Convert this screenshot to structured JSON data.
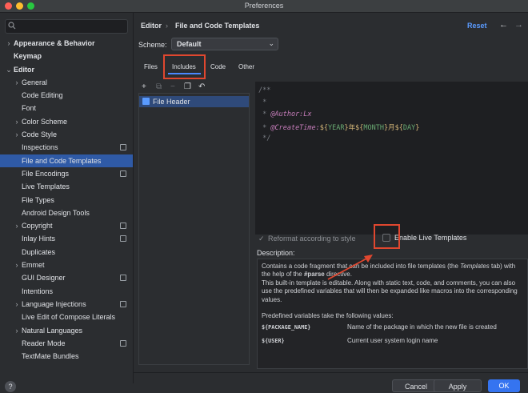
{
  "window": {
    "title": "Preferences"
  },
  "sidebar": {
    "items": [
      {
        "label": "Appearance & Behavior",
        "indent": 0,
        "chevron": "›",
        "bold": true
      },
      {
        "label": "Keymap",
        "indent": 0,
        "chevron": "",
        "bold": true
      },
      {
        "label": "Editor",
        "indent": 0,
        "chevron": "⌄",
        "bold": true
      },
      {
        "label": "General",
        "indent": 1,
        "chevron": "›"
      },
      {
        "label": "Code Editing",
        "indent": 1,
        "chevron": ""
      },
      {
        "label": "Font",
        "indent": 1,
        "chevron": ""
      },
      {
        "label": "Color Scheme",
        "indent": 1,
        "chevron": "›"
      },
      {
        "label": "Code Style",
        "indent": 1,
        "chevron": "›"
      },
      {
        "label": "Inspections",
        "indent": 1,
        "chevron": "",
        "gear": true
      },
      {
        "label": "File and Code Templates",
        "indent": 1,
        "chevron": "",
        "selected": true
      },
      {
        "label": "File Encodings",
        "indent": 1,
        "chevron": "",
        "gear": true
      },
      {
        "label": "Live Templates",
        "indent": 1,
        "chevron": ""
      },
      {
        "label": "File Types",
        "indent": 1,
        "chevron": ""
      },
      {
        "label": "Android Design Tools",
        "indent": 1,
        "chevron": ""
      },
      {
        "label": "Copyright",
        "indent": 1,
        "chevron": "›",
        "gear": true
      },
      {
        "label": "Inlay Hints",
        "indent": 1,
        "chevron": "",
        "gear": true
      },
      {
        "label": "Duplicates",
        "indent": 1,
        "chevron": ""
      },
      {
        "label": "Emmet",
        "indent": 1,
        "chevron": "›"
      },
      {
        "label": "GUI Designer",
        "indent": 1,
        "chevron": "",
        "gear": true
      },
      {
        "label": "Intentions",
        "indent": 1,
        "chevron": ""
      },
      {
        "label": "Language Injections",
        "indent": 1,
        "chevron": "›",
        "gear": true
      },
      {
        "label": "Live Edit of Compose Literals",
        "indent": 1,
        "chevron": ""
      },
      {
        "label": "Natural Languages",
        "indent": 1,
        "chevron": "›"
      },
      {
        "label": "Reader Mode",
        "indent": 1,
        "chevron": "",
        "gear": true
      },
      {
        "label": "TextMate Bundles",
        "indent": 1,
        "chevron": ""
      }
    ],
    "help_label": "?"
  },
  "header": {
    "crumb_root": "Editor",
    "crumb_sep": "›",
    "crumb_page": "File and Code Templates",
    "reset_label": "Reset",
    "back_icon": "←",
    "forward_icon": "→"
  },
  "scheme": {
    "label": "Scheme:",
    "value": "Default",
    "chevron": "⌄"
  },
  "tabs": [
    {
      "label": "Files",
      "selected": false
    },
    {
      "label": "Includes",
      "selected": true
    },
    {
      "label": "Code",
      "selected": false
    },
    {
      "label": "Other",
      "selected": false
    }
  ],
  "toolbar": {
    "add": "+",
    "copy": "⧉",
    "remove": "−",
    "duplicate": "❐",
    "revert": "↶"
  },
  "templates": {
    "items": [
      {
        "label": "File Header"
      }
    ]
  },
  "editor": {
    "lines": [
      {
        "parts": [
          {
            "text": "/**",
            "cls": "c-comment"
          }
        ]
      },
      {
        "parts": [
          {
            "text": " *",
            "cls": "c-comment"
          }
        ]
      },
      {
        "parts": [
          {
            "text": " * ",
            "cls": "c-comment"
          },
          {
            "text": "@Author:Lx",
            "cls": "c-tag"
          }
        ]
      },
      {
        "parts": [
          {
            "text": " * ",
            "cls": "c-comment"
          },
          {
            "text": "@CreateTime:",
            "cls": "c-tag"
          },
          {
            "text": "${",
            "cls": "c-brace"
          },
          {
            "text": "YEAR",
            "cls": "c-var"
          },
          {
            "text": "}",
            "cls": "c-brace"
          },
          {
            "text": "年",
            "cls": "c-text"
          },
          {
            "text": "${",
            "cls": "c-brace"
          },
          {
            "text": "MONTH",
            "cls": "c-var"
          },
          {
            "text": "}",
            "cls": "c-brace"
          },
          {
            "text": "月",
            "cls": "c-text"
          },
          {
            "text": "${",
            "cls": "c-brace"
          },
          {
            "text": "DAY",
            "cls": "c-var"
          },
          {
            "text": "}",
            "cls": "c-brace"
          }
        ]
      },
      {
        "parts": [
          {
            "text": " */",
            "cls": "c-comment"
          }
        ]
      }
    ]
  },
  "options": {
    "reformat_check": "✓",
    "reformat_label": "Reformat according to style",
    "live_templates_label": "Enable Live Templates"
  },
  "description": {
    "label": "Description:",
    "p1_a": "Contains a code fragment that can be included into file templates (the ",
    "p1_em": "Templates",
    "p1_b": " tab) with the help of the ",
    "p1_code": "#parse",
    "p1_c": " directive.",
    "p2": "This built-in template is editable. Along with static text, code, and comments, you can also use the predefined variables that will then be expanded like macros into the corresponding values.",
    "p3": "Predefined variables take the following values:",
    "vars": [
      {
        "name": "${PACKAGE_NAME}",
        "desc": "Name of the package in which the new file is created"
      },
      {
        "name": "${USER}",
        "desc": "Current user system login name"
      }
    ]
  },
  "footer": {
    "cancel_label": "Cancel",
    "apply_label": "Apply",
    "ok_label": "OK"
  },
  "colors": {
    "accent": "#4a88ff",
    "selection": "#2f5aa6",
    "annotation": "#e0472f",
    "ok_button": "#3574f0"
  }
}
